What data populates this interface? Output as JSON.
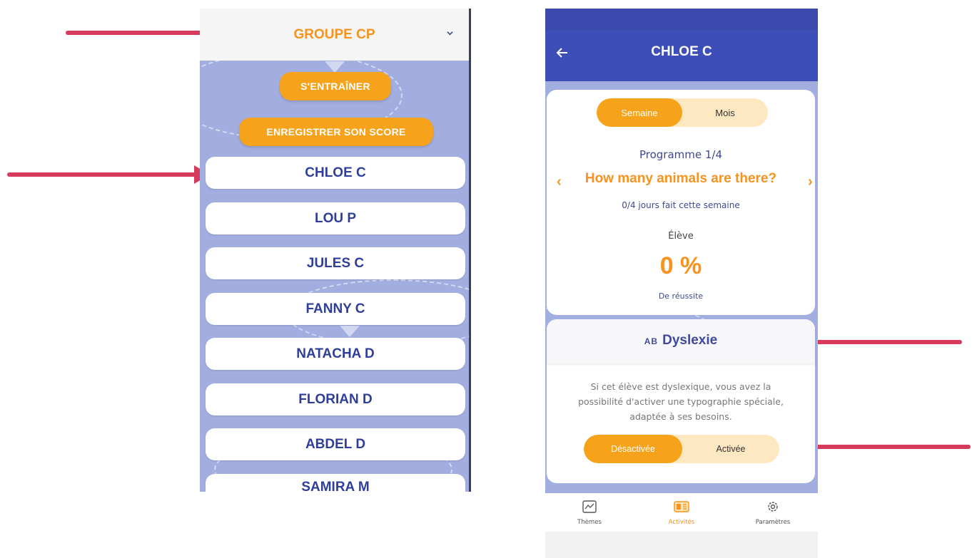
{
  "left_screen": {
    "group_name": "GROUPE CP",
    "buttons": {
      "train": "S'ENTRAÎNER",
      "record_score": "ENREGISTRER SON SCORE"
    },
    "students": [
      "CHLOE C",
      "LOU P",
      "JULES C",
      "FANNY C",
      "NATACHA D",
      "FLORIAN D",
      "ABDEL D",
      "SAMIRA M"
    ]
  },
  "right_screen": {
    "header": {
      "title": "CHLOE C"
    },
    "period_toggle": {
      "options": [
        "Semaine",
        "Mois"
      ],
      "selected": "Semaine"
    },
    "program": {
      "label": "Programme 1/4",
      "title": "How many animals are there?",
      "days": "0/4 jours fait cette semaine"
    },
    "score": {
      "label": "Élève",
      "value": "0 %",
      "caption": "De réussite"
    },
    "dyslexia": {
      "icon": "AB",
      "title": "Dyslexie",
      "description": "Si cet élève est dyslexique, vous avez la possibilité d'activer une typographie spéciale, adaptée à ses besoins.",
      "toggle": {
        "options": [
          "Désactivée",
          "Activée"
        ],
        "selected": "Désactivée"
      }
    },
    "bottom_nav": [
      {
        "label": "Thèmes",
        "icon": "chart-icon",
        "active": false
      },
      {
        "label": "Activités",
        "icon": "activities-icon",
        "active": true
      },
      {
        "label": "Paramètres",
        "icon": "settings-gear-icon",
        "active": false
      }
    ]
  },
  "colors": {
    "orange": "#f7a21b",
    "navy": "#3e4eb8",
    "lavender": "#a3aee0",
    "arrow": "#d63a5c"
  }
}
